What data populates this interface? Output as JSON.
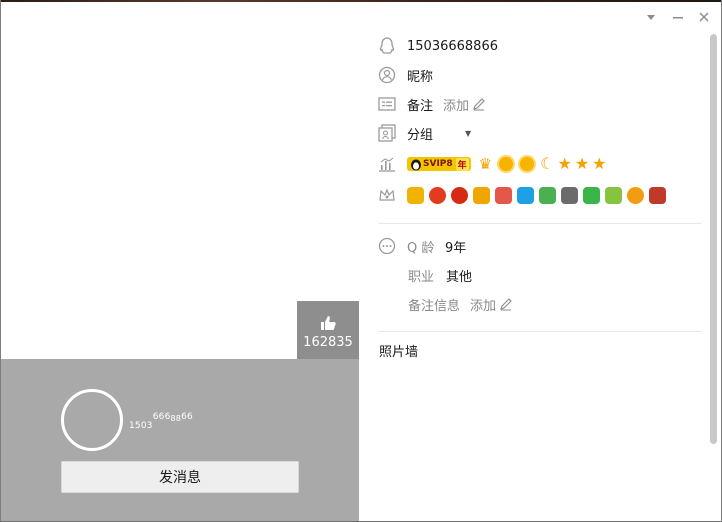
{
  "left": {
    "like_count": "162835",
    "qq_small": {
      "part1": "1503",
      "part2": "666",
      "part3": "88",
      "part4": "66"
    },
    "send_message_label": "发消息"
  },
  "right": {
    "qq_number": "15036668866",
    "nickname_label": "昵称",
    "remark_label": "备注",
    "remark_add": "添加",
    "group_label": "分组",
    "svip_text": "SVIP8",
    "svip_year": "年",
    "qage_label": "Q 龄",
    "qage_value": "9年",
    "job_label": "职业",
    "job_value": "其他",
    "remark_info_label": "备注信息",
    "remark_info_add": "添加",
    "photo_wall_label": "照片墙"
  },
  "colors": {
    "profile_bg": "#a9a9a9",
    "like_bg": "#8e8e8e",
    "muted_text": "#8a8a8a",
    "accent_gold": "#f5a300"
  },
  "icons": [
    "qq-penguin-icon",
    "user-circle-icon",
    "remark-card-icon",
    "group-icon",
    "level-chart-icon",
    "crown-outline-icon",
    "more-circle-icon",
    "thumbs-up-icon",
    "edit-pencil-icon",
    "chevron-down-icon",
    "minimize-icon",
    "close-icon"
  ]
}
